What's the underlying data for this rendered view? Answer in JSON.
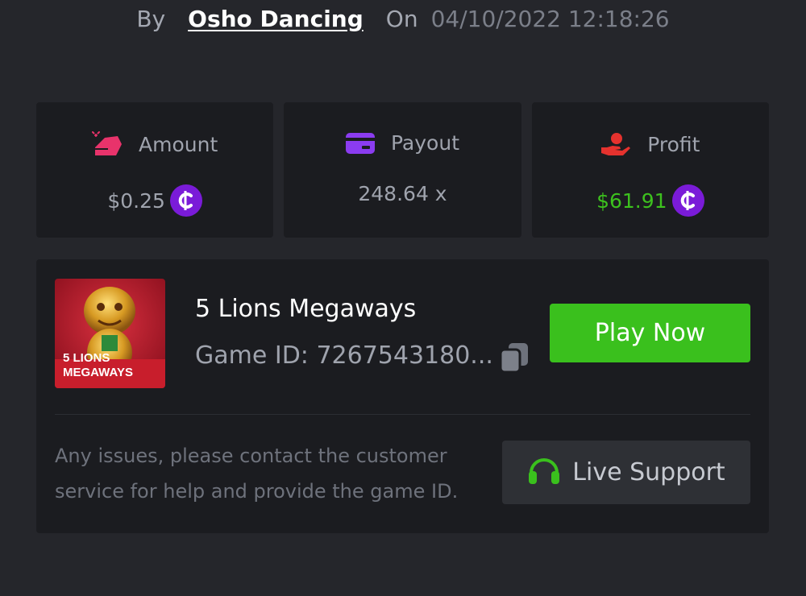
{
  "byline": {
    "by_label": "By",
    "username": "Osho Dancing",
    "on_label": "On",
    "datetime": "04/10/2022 12:18:26"
  },
  "stats": [
    {
      "label": "Amount",
      "value": "$0.25",
      "icon": "bet-amount-icon",
      "currency_icon": "coin-icon"
    },
    {
      "label": "Payout",
      "value": "248.64 x",
      "icon": "card-payout-icon"
    },
    {
      "label": "Profit",
      "value": "$61.91",
      "icon": "hand-profit-icon",
      "currency_icon": "coin-icon",
      "value_color": "#3dc11e"
    }
  ],
  "game": {
    "title": "5 Lions Megaways",
    "id_text": "Game ID: 7267543180...",
    "thumbnail_caption": [
      "5 LIONS",
      "MEGAWAYS"
    ],
    "play_label": "Play Now"
  },
  "help": {
    "text": "Any issues, please contact the customer service for help and provide the game ID.",
    "support_label": "Live Support"
  },
  "colors": {
    "background": "#25262b",
    "panel": "#1b1c20",
    "accent_green": "#3ac01d",
    "coin_purple": "#7a1bd8",
    "amount_pink": "#e8336b",
    "payout_purple": "#8b3cf0",
    "profit_red": "#e5322e"
  }
}
